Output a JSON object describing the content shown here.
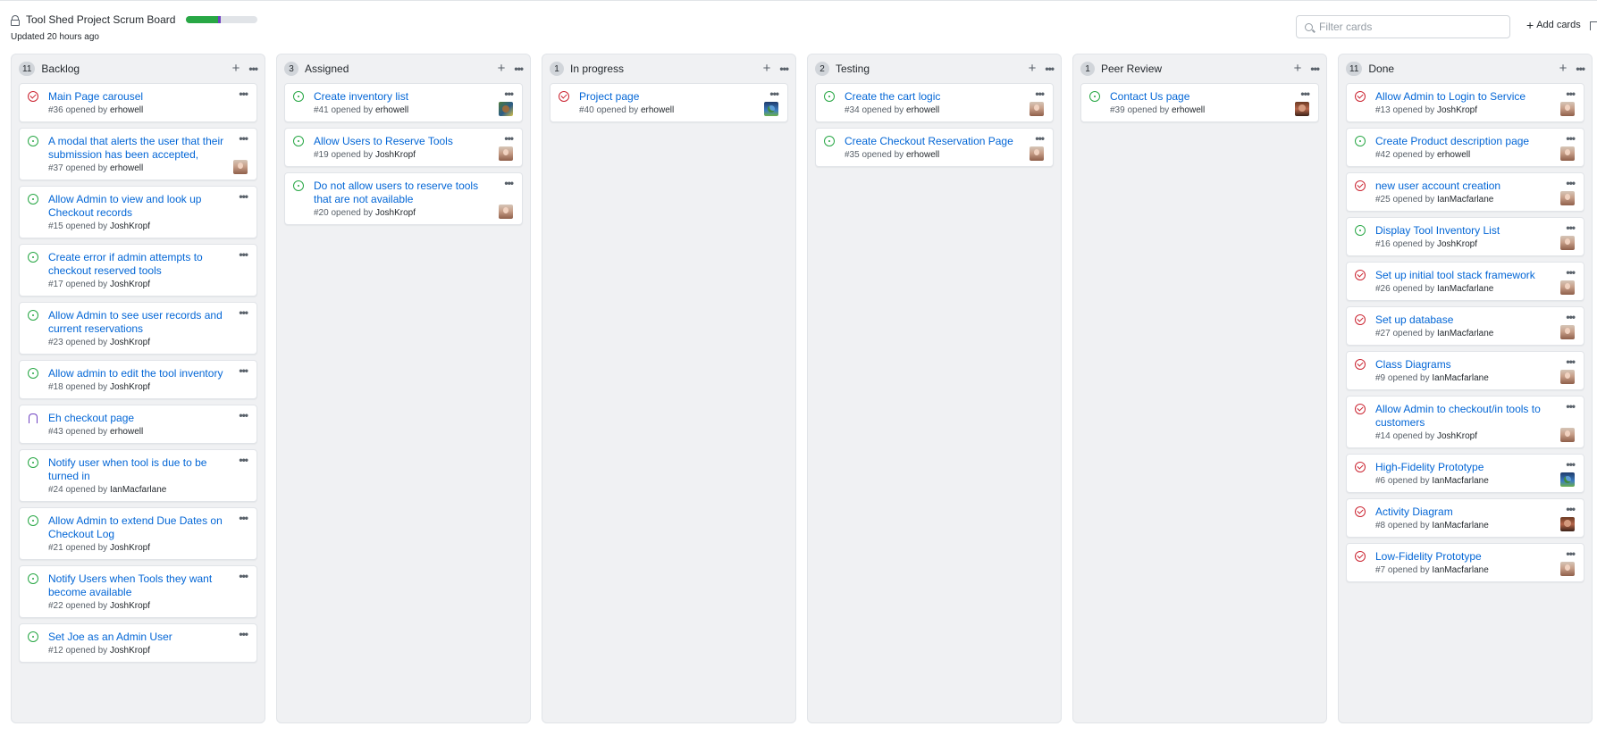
{
  "header": {
    "title": "Tool Shed Project Scrum Board",
    "updated": "Updated 20 hours ago",
    "progress": {
      "done_fraction": 0.44,
      "in_progress_fraction": 0.04
    },
    "filter_placeholder": "Filter cards",
    "add_cards_label": "Add cards"
  },
  "colors": {
    "link": "#0366d6",
    "open": "#28a745",
    "closed": "#cb2431",
    "pr": "#6f42c1"
  },
  "columns": [
    {
      "name": "Backlog",
      "count": "11",
      "cards": [
        {
          "title": "Main Page carousel",
          "number": "#36",
          "author": "erhowell",
          "state": "closed",
          "avatar": ""
        },
        {
          "title": "A modal that alerts the user that their submission has been accepted,",
          "number": "#37",
          "author": "erhowell",
          "state": "open",
          "avatar": "a"
        },
        {
          "title": "Allow Admin to view and look up Checkout records",
          "number": "#15",
          "author": "JoshKropf",
          "state": "open",
          "avatar": ""
        },
        {
          "title": "Create error if admin attempts to checkout reserved tools",
          "number": "#17",
          "author": "JoshKropf",
          "state": "open",
          "avatar": ""
        },
        {
          "title": "Allow Admin to see user records and current reservations",
          "number": "#23",
          "author": "JoshKropf",
          "state": "open",
          "avatar": ""
        },
        {
          "title": "Allow admin to edit the tool inventory",
          "number": "#18",
          "author": "JoshKropf",
          "state": "open",
          "avatar": ""
        },
        {
          "title": "Eh checkout page",
          "number": "#43",
          "author": "erhowell",
          "state": "pr",
          "avatar": ""
        },
        {
          "title": "Notify user when tool is due to be turned in",
          "number": "#24",
          "author": "IanMacfarlane",
          "state": "open",
          "avatar": ""
        },
        {
          "title": "Allow Admin to extend Due Dates on Checkout Log",
          "number": "#21",
          "author": "JoshKropf",
          "state": "open",
          "avatar": ""
        },
        {
          "title": "Notify Users when Tools they want become available",
          "number": "#22",
          "author": "JoshKropf",
          "state": "open",
          "avatar": ""
        },
        {
          "title": "Set Joe as an Admin User",
          "number": "#12",
          "author": "JoshKropf",
          "state": "open",
          "avatar": ""
        }
      ]
    },
    {
      "name": "Assigned",
      "count": "3",
      "cards": [
        {
          "title": "Create inventory list",
          "number": "#41",
          "author": "erhowell",
          "state": "open",
          "avatar": "b"
        },
        {
          "title": "Allow Users to Reserve Tools",
          "number": "#19",
          "author": "JoshKropf",
          "state": "open",
          "avatar": "a"
        },
        {
          "title": "Do not allow users to reserve tools that are not available",
          "number": "#20",
          "author": "JoshKropf",
          "state": "open",
          "avatar": "a"
        }
      ]
    },
    {
      "name": "In progress",
      "count": "1",
      "cards": [
        {
          "title": "Project page",
          "number": "#40",
          "author": "erhowell",
          "state": "closed",
          "avatar": "c"
        }
      ]
    },
    {
      "name": "Testing",
      "count": "2",
      "cards": [
        {
          "title": "Create the cart logic",
          "number": "#34",
          "author": "erhowell",
          "state": "open",
          "avatar": "a"
        },
        {
          "title": "Create Checkout Reservation Page",
          "number": "#35",
          "author": "erhowell",
          "state": "open",
          "avatar": "a"
        }
      ]
    },
    {
      "name": "Peer Review",
      "count": "1",
      "cards": [
        {
          "title": "Contact Us page",
          "number": "#39",
          "author": "erhowell",
          "state": "open",
          "avatar": "d"
        }
      ]
    },
    {
      "name": "Done",
      "count": "11",
      "cards": [
        {
          "title": "Allow Admin to Login to Service",
          "number": "#13",
          "author": "JoshKropf",
          "state": "closed",
          "avatar": "a"
        },
        {
          "title": "Create Product description page",
          "number": "#42",
          "author": "erhowell",
          "state": "open",
          "avatar": "a"
        },
        {
          "title": "new user account creation",
          "number": "#25",
          "author": "IanMacfarlane",
          "state": "closed",
          "avatar": "a"
        },
        {
          "title": "Display Tool Inventory List",
          "number": "#16",
          "author": "JoshKropf",
          "state": "open",
          "avatar": "a"
        },
        {
          "title": "Set up initial tool stack framework",
          "number": "#26",
          "author": "IanMacfarlane",
          "state": "closed",
          "avatar": "a"
        },
        {
          "title": "Set up database",
          "number": "#27",
          "author": "IanMacfarlane",
          "state": "closed",
          "avatar": "a"
        },
        {
          "title": "Class Diagrams",
          "number": "#9",
          "author": "IanMacfarlane",
          "state": "closed",
          "avatar": "a"
        },
        {
          "title": "Allow Admin to checkout/in tools to customers",
          "number": "#14",
          "author": "JoshKropf",
          "state": "closed",
          "avatar": "a"
        },
        {
          "title": "High-Fidelity Prototype",
          "number": "#6",
          "author": "IanMacfarlane",
          "state": "closed",
          "avatar": "c"
        },
        {
          "title": "Activity Diagram",
          "number": "#8",
          "author": "IanMacfarlane",
          "state": "closed",
          "avatar": "d"
        },
        {
          "title": "Low-Fidelity Prototype",
          "number": "#7",
          "author": "IanMacfarlane",
          "state": "closed",
          "avatar": "a"
        }
      ]
    }
  ]
}
